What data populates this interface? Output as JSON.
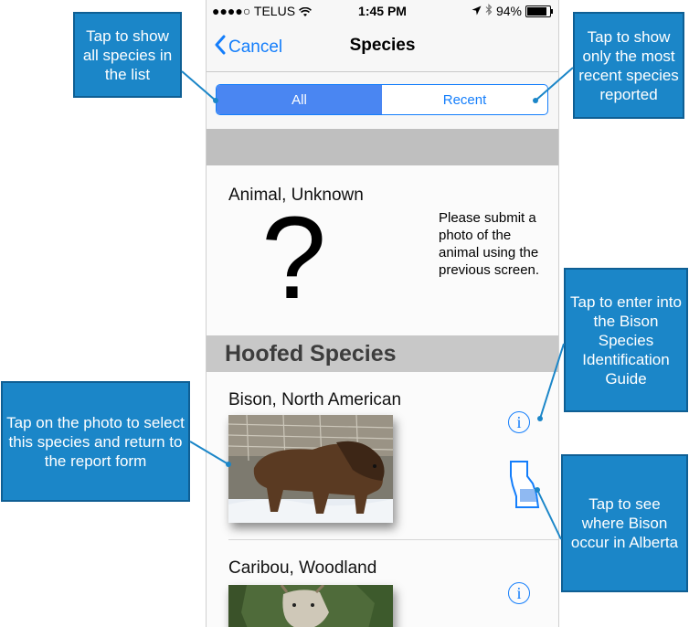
{
  "status_bar": {
    "carrier": "●●●●○ TELUS",
    "time": "1:45 PM",
    "battery": "94%"
  },
  "nav": {
    "cancel_label": "Cancel",
    "title": "Species"
  },
  "segments": {
    "all": "All",
    "recent": "Recent",
    "selected": "All"
  },
  "unknown": {
    "name": "Animal, Unknown",
    "symbol": "?",
    "note": "Please submit a photo of the animal using the previous screen."
  },
  "section": {
    "title": "Hoofed Species"
  },
  "species": [
    {
      "name": "Bison, North American"
    },
    {
      "name": "Caribou, Woodland"
    }
  ],
  "callouts": {
    "all": "Tap to show all species in the list",
    "recent": "Tap to show only the most recent species reported",
    "info": "Tap to enter into the Bison Species Identification Guide",
    "photo": "Tap on the photo to select this species and return to the report form",
    "map": "Tap to see where Bison occur in Alberta"
  },
  "colors": {
    "ios_blue": "#147efb",
    "segment_active": "#4a86f2",
    "callout_fill": "#1b86c8",
    "section_header": "#c8c8c8"
  }
}
